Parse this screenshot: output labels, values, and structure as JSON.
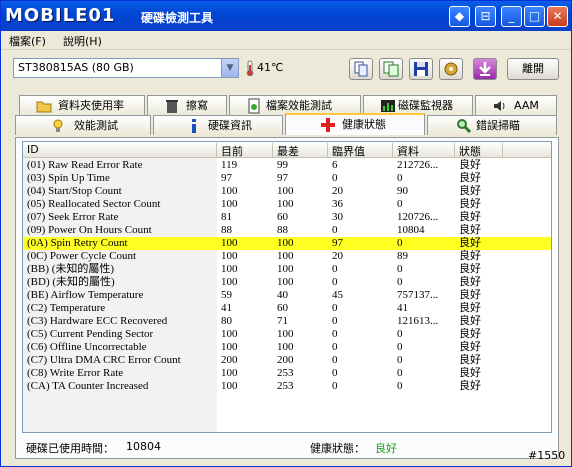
{
  "title_bar": {
    "brand": "MOBILE01",
    "title": "硬碟檢測工具",
    "buttons": [
      "restore-small",
      "tray",
      "minimize",
      "maximize",
      "close"
    ]
  },
  "menu": {
    "file": "檔案(F)",
    "help": "說明(H)"
  },
  "toolbar": {
    "drive": "ST380815AS (80 GB)",
    "temperature": "41℃",
    "close_label": "離開"
  },
  "tabs_row1": [
    {
      "label": "資料夾使用率",
      "icon": "folder-icon"
    },
    {
      "label": "擦寫",
      "icon": "trash-icon"
    },
    {
      "label": "檔案效能測試",
      "icon": "file-benchmark-icon"
    },
    {
      "label": "磁碟監視器",
      "icon": "disk-monitor-icon"
    },
    {
      "label": "AAM",
      "icon": "speaker-icon"
    }
  ],
  "tabs_row2": [
    {
      "label": "效能測試",
      "icon": "lightbulb-icon"
    },
    {
      "label": "硬碟資訊",
      "icon": "info-icon"
    },
    {
      "label": "健康狀態",
      "icon": "health-cross-icon"
    },
    {
      "label": "錯誤掃瞄",
      "icon": "magnifier-icon"
    }
  ],
  "table": {
    "headers": [
      "ID",
      "目前",
      "最差",
      "臨界值",
      "資料",
      "狀態"
    ],
    "rows": [
      [
        "(01) Raw Read Error Rate",
        "119",
        "99",
        "6",
        "212726...",
        "良好"
      ],
      [
        "(03) Spin Up Time",
        "97",
        "97",
        "0",
        "0",
        "良好"
      ],
      [
        "(04) Start/Stop Count",
        "100",
        "100",
        "20",
        "90",
        "良好"
      ],
      [
        "(05) Reallocated Sector Count",
        "100",
        "100",
        "36",
        "0",
        "良好"
      ],
      [
        "(07) Seek Error Rate",
        "81",
        "60",
        "30",
        "120726...",
        "良好"
      ],
      [
        "(09) Power On Hours Count",
        "88",
        "88",
        "0",
        "10804",
        "良好"
      ],
      [
        "(0A) Spin Retry Count",
        "100",
        "100",
        "97",
        "0",
        "良好"
      ],
      [
        "(0C) Power Cycle Count",
        "100",
        "100",
        "20",
        "89",
        "良好"
      ],
      [
        "(BB) (未知的屬性)",
        "100",
        "100",
        "0",
        "0",
        "良好"
      ],
      [
        "(BD) (未知的屬性)",
        "100",
        "100",
        "0",
        "0",
        "良好"
      ],
      [
        "(BE) Airflow Temperature",
        "59",
        "40",
        "45",
        "757137...",
        "良好"
      ],
      [
        "(C2) Temperature",
        "41",
        "60",
        "0",
        "41",
        "良好"
      ],
      [
        "(C3) Hardware ECC Recovered",
        "80",
        "71",
        "0",
        "121613...",
        "良好"
      ],
      [
        "(C5) Current Pending Sector",
        "100",
        "100",
        "0",
        "0",
        "良好"
      ],
      [
        "(C6) Offline Uncorrectable",
        "100",
        "100",
        "0",
        "0",
        "良好"
      ],
      [
        "(C7) Ultra DMA CRC Error Count",
        "200",
        "200",
        "0",
        "0",
        "良好"
      ],
      [
        "(C8) Write Error Rate",
        "100",
        "253",
        "0",
        "0",
        "良好"
      ],
      [
        "(CA) TA Counter Increased",
        "100",
        "253",
        "0",
        "0",
        "良好"
      ]
    ],
    "highlight_row": 6,
    "highlight_color": "#ffff22"
  },
  "footer": {
    "usage_label": "硬碟已使用時間：",
    "usage_value": "10804",
    "health_label": "健康狀態：",
    "health_value": "良好"
  },
  "watermark": "#1550"
}
